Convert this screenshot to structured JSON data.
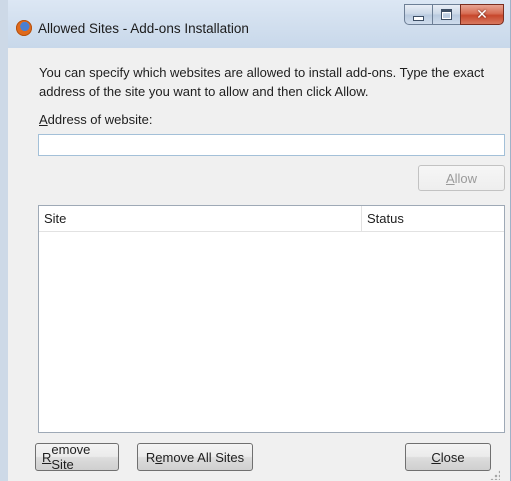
{
  "window": {
    "title": "Allowed Sites - Add-ons Installation",
    "icon": "firefox-icon",
    "caption_buttons": [
      "minimize",
      "maximize",
      "close"
    ]
  },
  "description": "You can specify which websites are allowed to install add-ons. Type the exact address of the site you want to allow and then click Allow.",
  "address": {
    "label_accel": "A",
    "label_rest": "ddress of website:",
    "value": "",
    "placeholder": ""
  },
  "allow_button": {
    "accel": "A",
    "rest": "llow",
    "enabled": false
  },
  "table": {
    "columns": [
      "Site",
      "Status"
    ],
    "rows": []
  },
  "buttons": {
    "remove_site": {
      "accel": "R",
      "rest": "emove Site"
    },
    "remove_all_pre": "R",
    "remove_all_accel": "e",
    "remove_all_rest": "move All Sites",
    "close": {
      "accel": "C",
      "rest": "lose"
    }
  }
}
